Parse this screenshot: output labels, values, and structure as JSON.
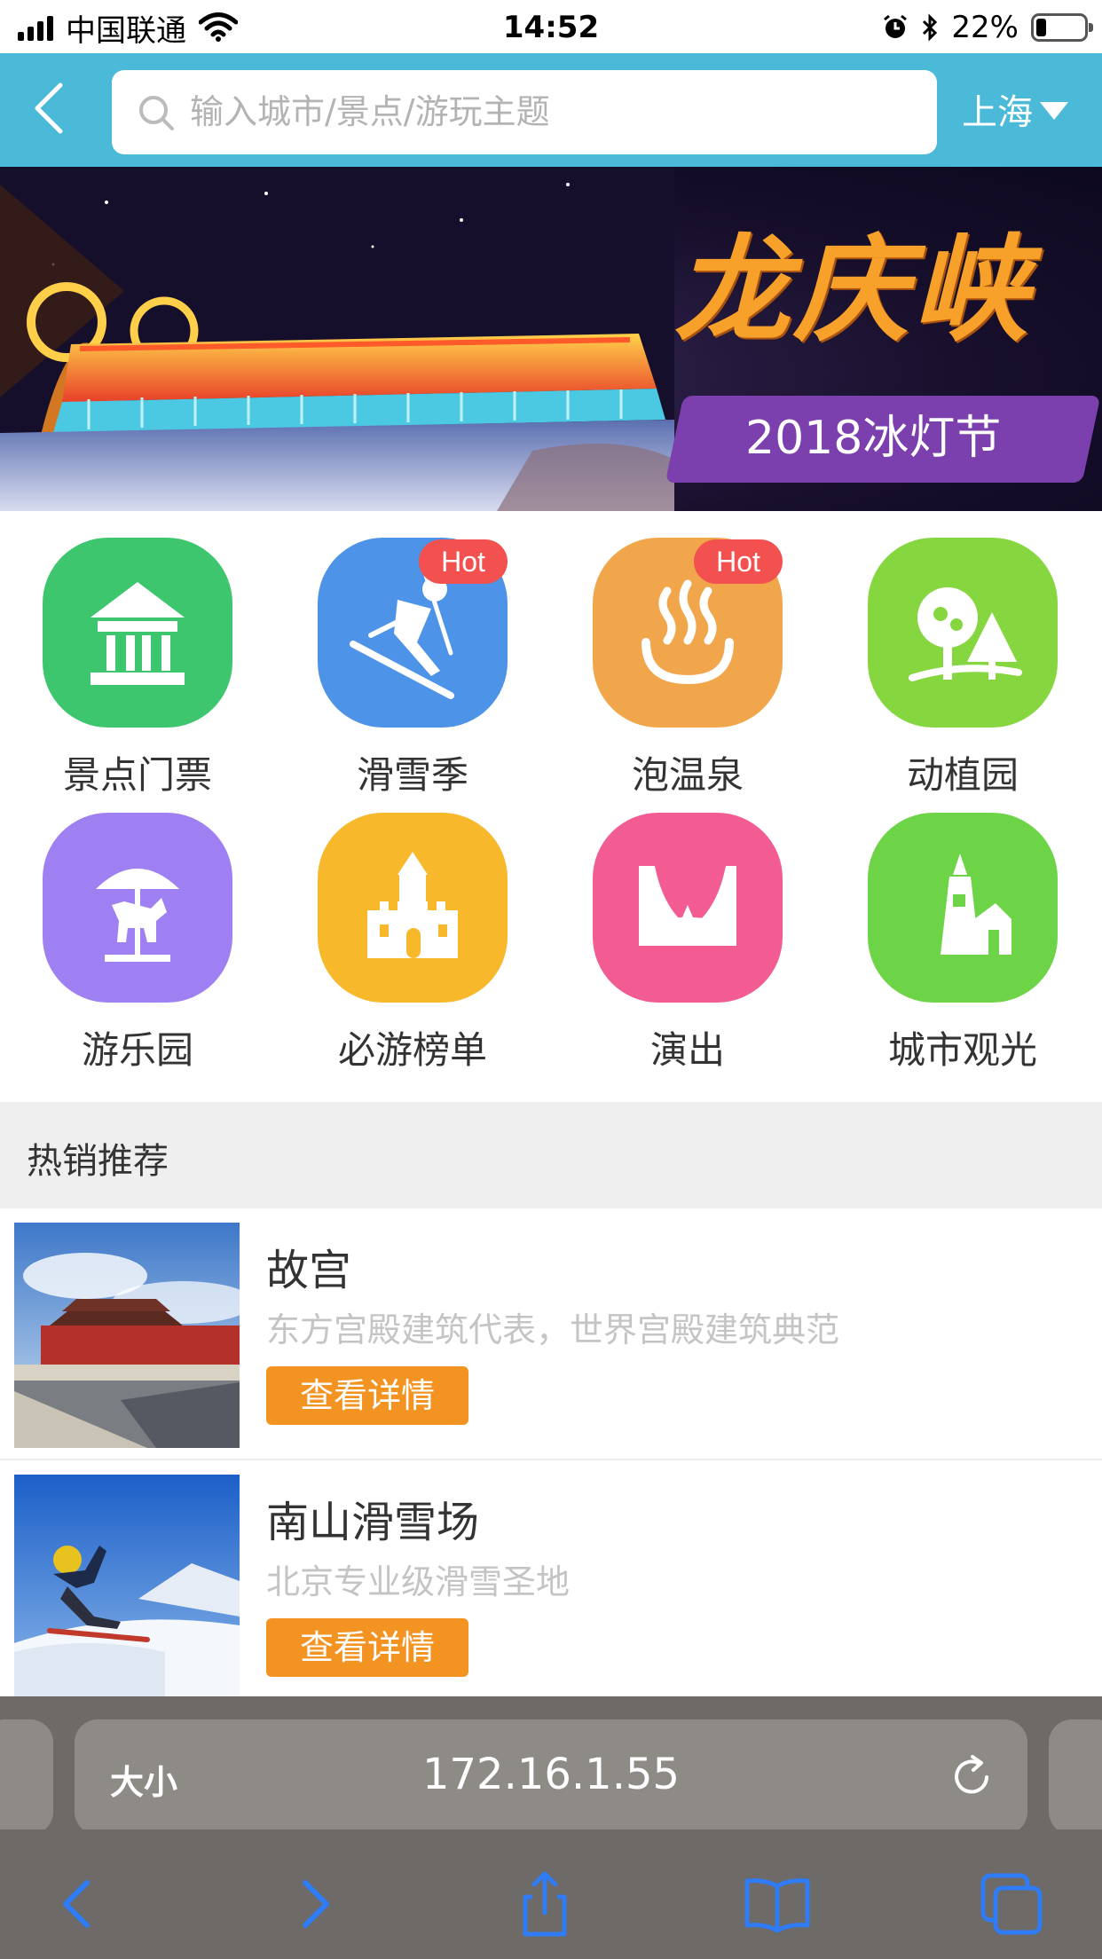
{
  "status_bar": {
    "carrier": "中国联通",
    "time": "14:52",
    "battery": "22%",
    "battery_level": 0.22
  },
  "header": {
    "search_placeholder": "输入城市/景点/游玩主题",
    "city": "上海"
  },
  "banner": {
    "title": "龙庆峡",
    "subtitle": "2018冰灯节"
  },
  "categories": [
    {
      "label": "景点门票",
      "icon": "pavilion-icon",
      "color": "#3ec66f",
      "hot": ""
    },
    {
      "label": "滑雪季",
      "icon": "skier-icon",
      "color": "#4d93e8",
      "hot": "Hot"
    },
    {
      "label": "泡温泉",
      "icon": "hot-spring-icon",
      "color": "#f2a64c",
      "hot": "Hot"
    },
    {
      "label": "动植园",
      "icon": "trees-icon",
      "color": "#86d640",
      "hot": ""
    },
    {
      "label": "游乐园",
      "icon": "carousel-icon",
      "color": "#9e80f2",
      "hot": ""
    },
    {
      "label": "必游榜单",
      "icon": "castle-icon",
      "color": "#f8b82c",
      "hot": ""
    },
    {
      "label": "演出",
      "icon": "stage-icon",
      "color": "#f25c93",
      "hot": ""
    },
    {
      "label": "城市观光",
      "icon": "lighthouse-icon",
      "color": "#6ed447",
      "hot": ""
    }
  ],
  "section": {
    "title": "热销推荐"
  },
  "products": [
    {
      "name": "故宫",
      "desc": "东方宫殿建筑代表，世界宫殿建筑典范",
      "button": "查看详情",
      "image": "forbidden-city-photo"
    },
    {
      "name": "南山滑雪场",
      "desc": "北京专业级滑雪圣地",
      "button": "查看详情",
      "image": "snowboarder-photo"
    }
  ],
  "browser": {
    "text_size": "大小",
    "url": "172.16.1.55"
  },
  "colors": {
    "header": "#4bbad8",
    "button": "#f39322",
    "hot_badge": "#f2514f"
  }
}
